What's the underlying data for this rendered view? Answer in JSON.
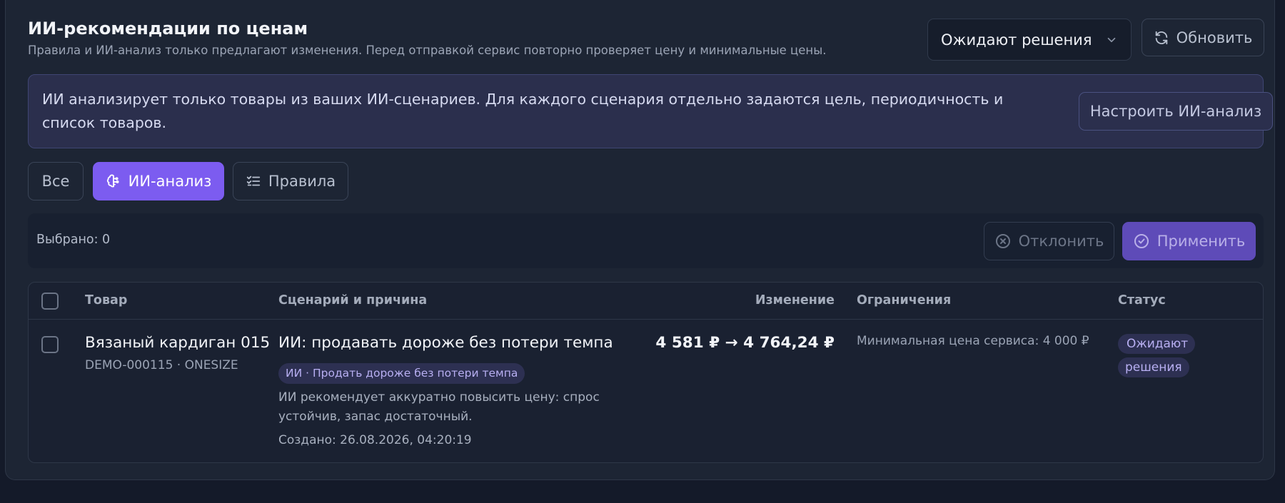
{
  "header": {
    "title": "ИИ-рекомендации по ценам",
    "subtitle": "Правила и ИИ-анализ только предлагают изменения. Перед отправкой сервис повторно проверяет цену и минимальные цены.",
    "status_filter": {
      "selected": "Ожидают решения",
      "icon": "chevron-down-icon"
    },
    "refresh_label": "Обновить",
    "refresh_icon": "refresh-icon"
  },
  "banner": {
    "text": "ИИ анализирует только товары из ваших ИИ-сценариев. Для каждого сценария отдельно задаются цель, периодичность и список товаров.",
    "button_label": "Настроить ИИ-анализ"
  },
  "filters": [
    {
      "label": "Все",
      "active": false
    },
    {
      "label": "ИИ-анализ",
      "active": true,
      "icon": "brain-icon"
    },
    {
      "label": "Правила",
      "active": false,
      "icon": "checklist-icon"
    }
  ],
  "toolbar": {
    "selected_text": "Выбрано: 0",
    "reject_label": "Отклонить",
    "reject_icon": "x-circle-icon",
    "apply_label": "Применить",
    "apply_icon": "check-circle-icon"
  },
  "table": {
    "columns": [
      "Товар",
      "Сценарий и причина",
      "Изменение",
      "Ограничения",
      "Статус"
    ],
    "rows": [
      {
        "product_name": "Вязаный кардиган 015",
        "product_sku": "DEMO-000115 · ONESIZE",
        "scenario_title": "ИИ: продавать дороже без потери темпа",
        "scenario_tag": "ИИ · Продать дороже без потери темпа",
        "reason": "ИИ рекомендует аккуратно повысить цену: спрос устойчив, запас достаточный.",
        "created": "Создано: 26.08.2026, 04:20:19",
        "change": "4 581 ₽ → 4 764,24 ₽",
        "limits": "Минимальная цена сервиса: 4 000 ₽",
        "status_line1": "Ожидают",
        "status_line2": "решения"
      }
    ]
  },
  "colors": {
    "accent": "#7c5cf0",
    "background": "#141a29",
    "card": "#1d2534",
    "banner": "#2b2f4d",
    "status_badge": "#2d3052"
  }
}
